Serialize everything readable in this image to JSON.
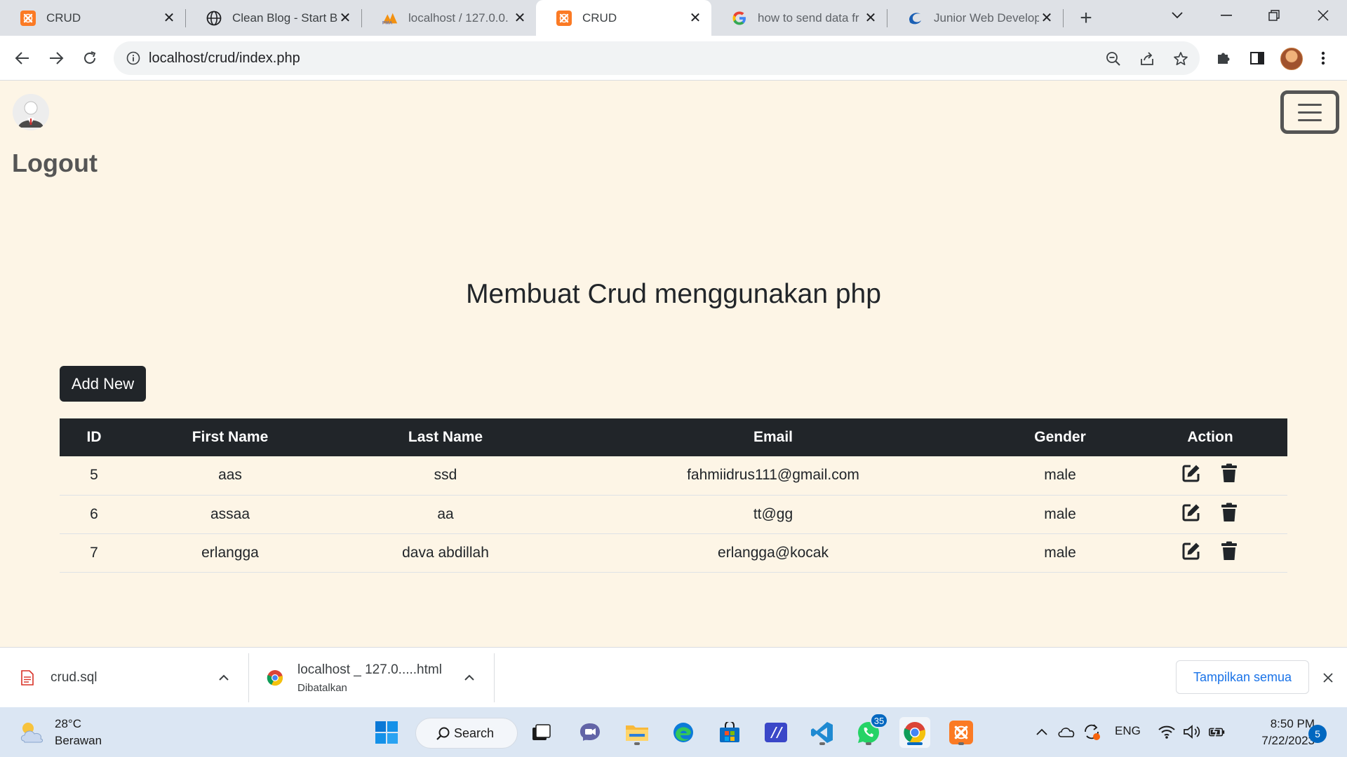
{
  "browser": {
    "tabs": [
      {
        "title": "CRUD",
        "icon": "xampp-icon",
        "active": false
      },
      {
        "title": "Clean Blog - Start B",
        "icon": "globe-icon",
        "active": false
      },
      {
        "title": "localhost / 127.0.0.",
        "icon": "phpmyadmin-icon",
        "active": false
      },
      {
        "title": "CRUD",
        "icon": "xampp-icon",
        "active": true
      },
      {
        "title": "how to send data fr",
        "icon": "google-icon",
        "active": false
      },
      {
        "title": "Junior Web Develop",
        "icon": "edge-style-icon",
        "active": false
      }
    ],
    "url": "localhost/crud/index.php"
  },
  "page": {
    "logout_label": "Logout",
    "heading": "Membuat Crud menggunakan php",
    "add_button_label": "Add New",
    "table": {
      "headers": [
        "ID",
        "First Name",
        "Last Name",
        "Email",
        "Gender",
        "Action"
      ],
      "rows": [
        {
          "id": "5",
          "first_name": "aas",
          "last_name": "ssd",
          "email": "fahmiidrus111@gmail.com",
          "gender": "male"
        },
        {
          "id": "6",
          "first_name": "assaa",
          "last_name": "aa",
          "email": "tt@gg",
          "gender": "male"
        },
        {
          "id": "7",
          "first_name": "erlangga",
          "last_name": "dava abdillah",
          "email": "erlangga@kocak",
          "gender": "male"
        }
      ]
    }
  },
  "downloads": {
    "items": [
      {
        "name": "crud.sql",
        "status": ""
      },
      {
        "name": "localhost _ 127.0.....html",
        "status": "Dibatalkan"
      }
    ],
    "show_all_label": "Tampilkan semua"
  },
  "taskbar": {
    "weather_temp": "28°C",
    "weather_desc": "Berawan",
    "search_label": "Search",
    "whatsapp_badge": "35",
    "language": "ENG",
    "time": "8:50 PM",
    "date": "7/22/2023",
    "notification_count": "5"
  },
  "colors": {
    "page_background": "#fdf5e6",
    "table_header": "#212529",
    "link_blue": "#1a73e8",
    "xampp_orange": "#fb7a24"
  }
}
